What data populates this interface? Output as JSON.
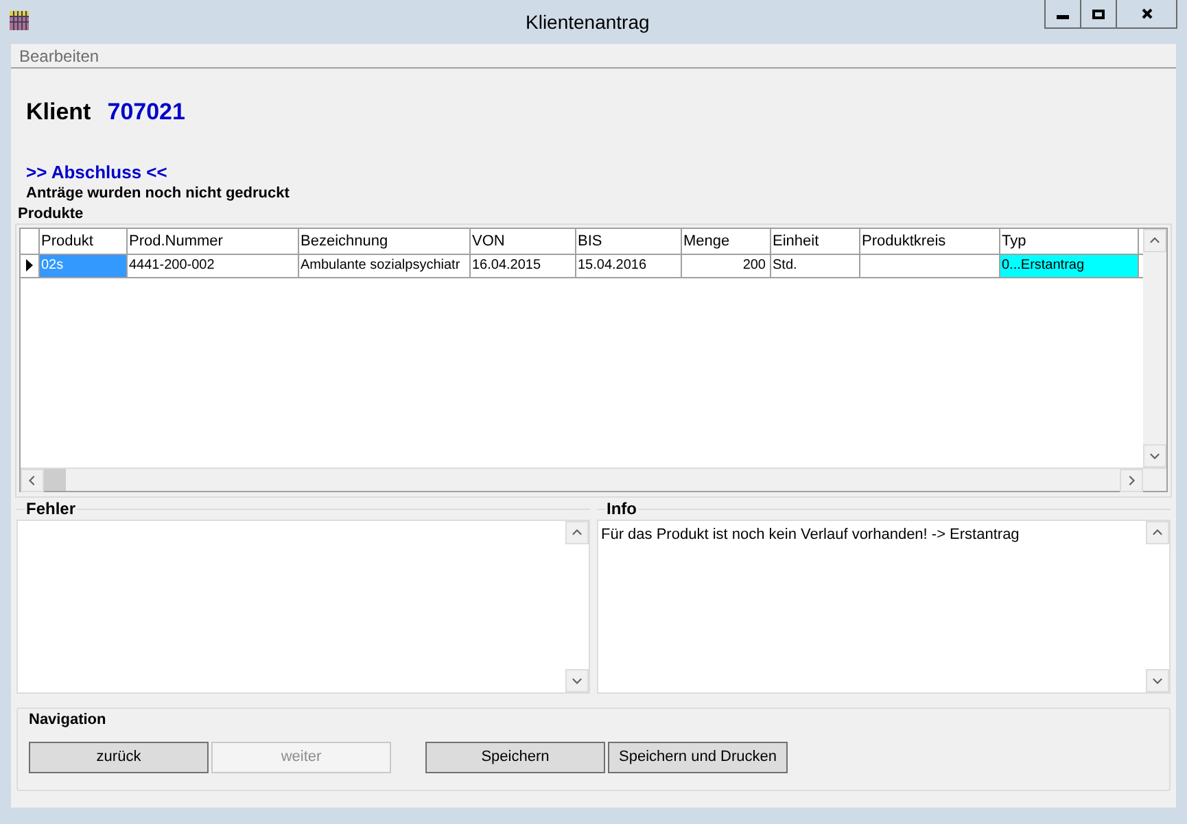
{
  "window": {
    "title": "Klientenantrag"
  },
  "menu": [
    "Bearbeiten"
  ],
  "client": {
    "label": "Klient",
    "number": "707021"
  },
  "step": {
    "title": ">> Abschluss <<",
    "message": "Anträge wurden noch nicht gedruckt"
  },
  "products": {
    "title": "Produkte",
    "columns": [
      "Produkt",
      "Prod.Nummer",
      "Bezeichnung",
      "VON",
      "BIS",
      "Menge",
      "Einheit",
      "Produktkreis",
      "Typ"
    ],
    "rows": [
      {
        "selected": true,
        "cells": [
          "02s",
          "4441-200-002",
          "Ambulante sozialpsychiatr",
          "16.04.2015",
          "15.04.2016",
          "200",
          "Std.",
          "",
          "0...Erstantrag"
        ],
        "color": "#00ffff"
      }
    ]
  },
  "errors": {
    "title": "Fehler"
  },
  "info": {
    "title": "Info",
    "text": "Für das Produkt ist noch kein Verlauf vorhanden! -> Erstantrag"
  },
  "navigation": {
    "title": "Navigation",
    "buttons": [
      {
        "label": "zurück",
        "disabled": false
      },
      {
        "label": "weiter",
        "disabled": true
      },
      {
        "label": "Speichern",
        "disabled": false
      },
      {
        "label": "Speichern und Drucken",
        "disabled": false
      }
    ]
  }
}
